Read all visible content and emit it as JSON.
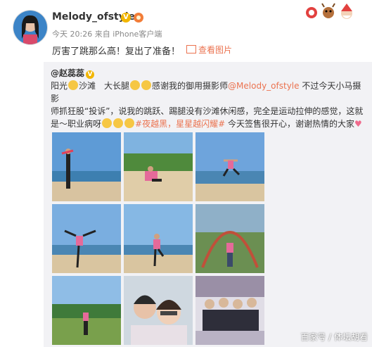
{
  "user": {
    "name": "Melody_ofstyle",
    "time": "今天 20:26",
    "source": "来自 iPhone客户端"
  },
  "post": {
    "text": "厉害了跳那么高！复出了准备！",
    "view_pictures": "查看图片"
  },
  "repost": {
    "author": "@赵蕊蕊",
    "line1a": "阳光",
    "line1b": "沙滩　大长腿",
    "line1c": "感谢我的御用摄影师",
    "mention": "@Melody_ofstyle",
    "line1d": " 不过今天小马摄影",
    "line2": "师抓狂股“投诉”，说我的跳跃、踢腿没有沙滩休闲感，完全是运动拉伸的感觉，这就",
    "line3a": "是～职业病呀",
    "hashtag1": "#夜越黑，星星越闪耀#",
    "line3b": " 今天签售很开心，谢谢热情的大家",
    "heart": "♥"
  },
  "watermark": "百家号 / 体坛胡看",
  "colors": {
    "link": "#eb7350",
    "repost_bg": "#f2f2f5",
    "badge": "#f2b600"
  },
  "icons": [
    "vip-icon",
    "level-icon",
    "picture-icon",
    "christmas-decoration-icon",
    "emoji-icon"
  ]
}
